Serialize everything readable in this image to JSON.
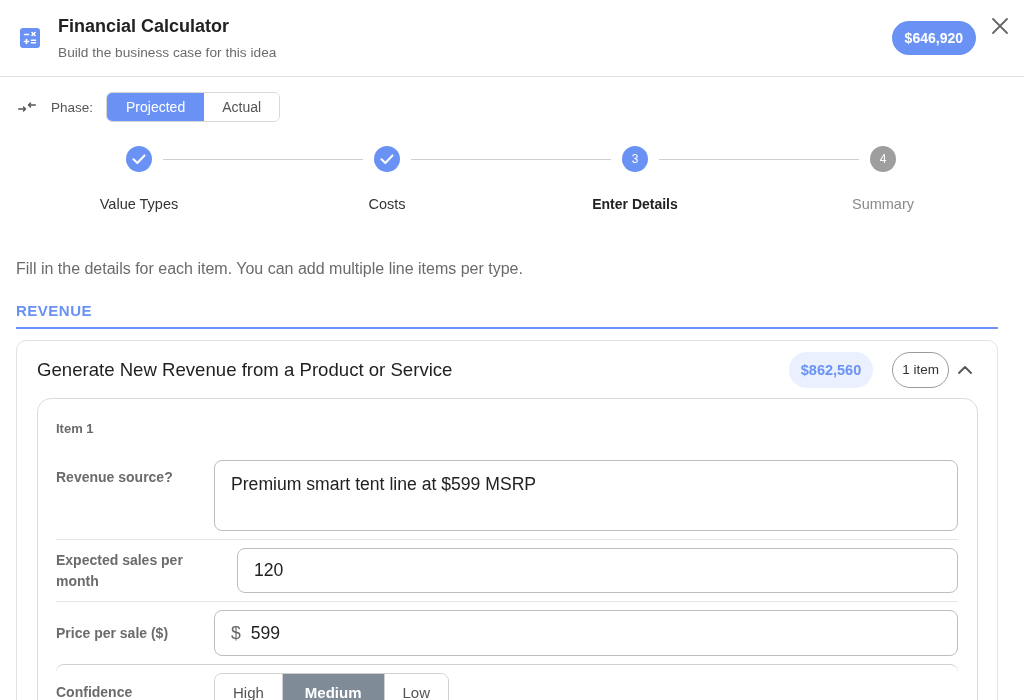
{
  "header": {
    "title": "Financial Calculator",
    "subtitle": "Build the business case for this idea",
    "total": "$646,920"
  },
  "phase": {
    "label": "Phase:",
    "options": [
      {
        "label": "Projected",
        "selected": true
      },
      {
        "label": "Actual",
        "selected": false
      }
    ]
  },
  "steps": [
    {
      "label": "Value Types",
      "completed": true,
      "current": false
    },
    {
      "label": "Costs",
      "completed": true,
      "current": false
    },
    {
      "label": "Enter Details",
      "completed": false,
      "current": true,
      "number": "3"
    },
    {
      "label": "Summary",
      "completed": false,
      "current": false,
      "number": "4"
    }
  ],
  "instructions": "Fill in the details for each item. You can add multiple line items per type.",
  "section": {
    "title": "REVENUE"
  },
  "groups": [
    {
      "title": "Generate New Revenue from a Product or Service",
      "total": "$862,560",
      "count": "1 item",
      "expanded": true,
      "items": [
        {
          "title": "Item 1",
          "fields": [
            {
              "kind": "textarea",
              "label": "Revenue source?",
              "value": "Premium smart tent line at $599 MSRP"
            },
            {
              "kind": "text",
              "label": "Expected sales per month",
              "value": "120"
            },
            {
              "kind": "currency",
              "label": "Price per sale ($)",
              "prefix": "$",
              "value": "599"
            },
            {
              "kind": "choice",
              "label": "Confidence",
              "options": [
                {
                  "label": "High",
                  "selected": false
                },
                {
                  "label": "Medium",
                  "selected": true
                },
                {
                  "label": "Low",
                  "selected": false
                }
              ]
            }
          ]
        }
      ]
    }
  ]
}
